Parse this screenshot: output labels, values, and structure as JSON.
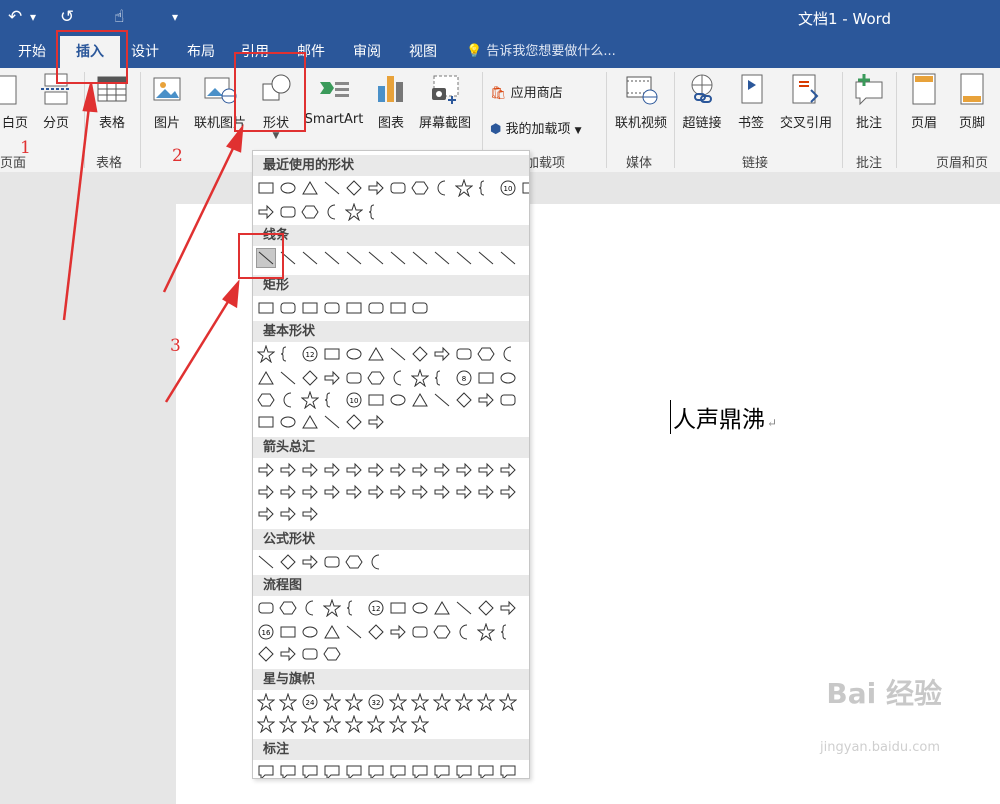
{
  "window": {
    "title": "文档1 - Word"
  },
  "qat": {
    "undo": "↶",
    "undo_menu": "▾",
    "redo": "↺",
    "touch": "☝",
    "more": "▾"
  },
  "tabs": [
    "开始",
    "插入",
    "设计",
    "布局",
    "引用",
    "邮件",
    "审阅",
    "视图"
  ],
  "tell_me": "告诉我您想要做什么...",
  "ribbon": {
    "page_items": [
      "白页",
      "分页"
    ],
    "page_group": "页面",
    "table": {
      "label": "表格",
      "group": "表格"
    },
    "illustrations": [
      "图片",
      "联机图片",
      "形状",
      "SmartArt",
      "图表",
      "屏幕截图"
    ],
    "addins": {
      "store": "应用商店",
      "my": "我的加载项",
      "group": "加载项"
    },
    "media": {
      "video": "联机视频",
      "group": "媒体"
    },
    "links": {
      "items": [
        "超链接",
        "书签",
        "交叉引用"
      ],
      "group": "链接"
    },
    "comments": {
      "item": "批注",
      "group": "批注"
    },
    "header_footer": {
      "items": [
        "页眉",
        "页脚"
      ],
      "group": "页眉和页脚"
    }
  },
  "annotations": {
    "step1": "1",
    "step2": "2",
    "step3": "3"
  },
  "shapes_menu": {
    "sections": [
      "最近使用的形状",
      "线条",
      "矩形",
      "基本形状",
      "箭头总汇",
      "公式形状",
      "流程图",
      "星与旗帜",
      "标注"
    ],
    "badge_labels": [
      "10",
      "12",
      "8",
      "10",
      "12",
      "16",
      "24",
      "32"
    ]
  },
  "document": {
    "text": "人声鼎沸",
    "para_mark": "↵"
  },
  "watermark": {
    "brand": "Bai 经验",
    "url": "jingyan.baidu.com"
  },
  "colors": {
    "accent": "#2b579a",
    "annotation": "#e03131"
  }
}
